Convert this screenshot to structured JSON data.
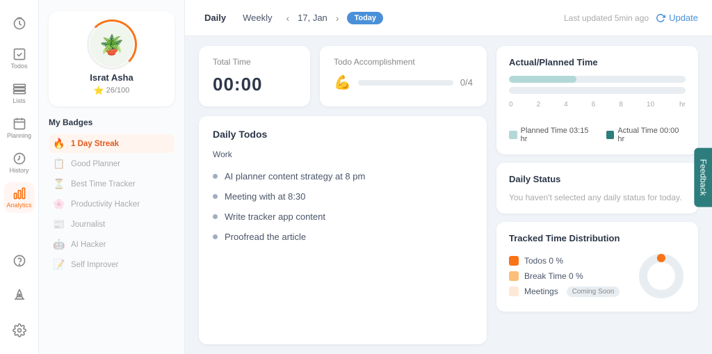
{
  "sidebar": {
    "items": [
      {
        "id": "timer",
        "label": "",
        "icon": "timer",
        "active": false
      },
      {
        "id": "todos",
        "label": "Todos",
        "icon": "check-square",
        "active": false
      },
      {
        "id": "lists",
        "label": "Lists",
        "icon": "layers",
        "active": false
      },
      {
        "id": "planning",
        "label": "Planning",
        "icon": "calendar",
        "active": false
      },
      {
        "id": "history",
        "label": "History",
        "icon": "clock",
        "active": false
      },
      {
        "id": "analytics",
        "label": "Analytics",
        "icon": "bar-chart",
        "active": true
      },
      {
        "id": "help",
        "label": "",
        "icon": "help-circle",
        "active": false
      },
      {
        "id": "rocket",
        "label": "",
        "icon": "rocket",
        "active": false
      },
      {
        "id": "settings",
        "label": "",
        "icon": "settings",
        "active": false
      }
    ]
  },
  "profile": {
    "name": "Israt Asha",
    "score": "26/100",
    "avatar_emoji": "🪴"
  },
  "badges": {
    "title": "My Badges",
    "items": [
      {
        "id": "streak",
        "icon": "🔥",
        "label": "1 Day Streak",
        "active": true
      },
      {
        "id": "planner",
        "icon": "📋",
        "label": "Good Planner",
        "active": false
      },
      {
        "id": "time-tracker",
        "icon": "⏳",
        "label": "Best Time Tracker",
        "active": false
      },
      {
        "id": "productivity",
        "icon": "🌸",
        "label": "Productivity Hacker",
        "active": false
      },
      {
        "id": "journalist",
        "icon": "📰",
        "label": "Journalist",
        "active": false
      },
      {
        "id": "ai-hacker",
        "icon": "🤖",
        "label": "AI Hacker",
        "active": false
      },
      {
        "id": "self-improver",
        "icon": "📝",
        "label": "Self Improver",
        "active": false
      }
    ]
  },
  "topbar": {
    "nav_daily": "Daily",
    "nav_weekly": "Weekly",
    "date": "17, Jan",
    "today_label": "Today",
    "last_updated": "Last updated 5min ago",
    "update_label": "Update"
  },
  "total_time": {
    "label": "Total Time",
    "value": "00:00"
  },
  "todo_accomplishment": {
    "label": "Todo Accomplishment",
    "count": "0/4",
    "progress": 0
  },
  "daily_todos": {
    "title": "Daily Todos",
    "groups": [
      {
        "label": "Work",
        "items": [
          {
            "text": "AI planner content strategy at 8 pm"
          },
          {
            "text": "Meeting with at 8:30"
          },
          {
            "text": "Write tracker app content"
          },
          {
            "text": "Proofread the article"
          }
        ]
      }
    ]
  },
  "actual_planned": {
    "title": "Actual/Planned Time",
    "planned_label": "Planned Time 03:15 hr",
    "actual_label": "Actual Time 00:00 hr",
    "planned_width": "38",
    "actual_width": "0",
    "axis_labels": [
      "0",
      "2",
      "4",
      "6",
      "8",
      "10"
    ],
    "axis_unit": "hr"
  },
  "daily_status": {
    "title": "Daily Status",
    "message": "You haven't selected any daily status for today."
  },
  "tracked_time": {
    "title": "Tracked Time Distribution",
    "items": [
      {
        "id": "todos",
        "label": "Todos 0 %",
        "color_class": "todos"
      },
      {
        "id": "break",
        "label": "Break Time 0 %",
        "color_class": "break"
      },
      {
        "id": "meetings",
        "label": "Meetings",
        "color_class": "meetings",
        "badge": "Coming Soon"
      }
    ]
  },
  "feedback": {
    "label": "Feedback"
  }
}
